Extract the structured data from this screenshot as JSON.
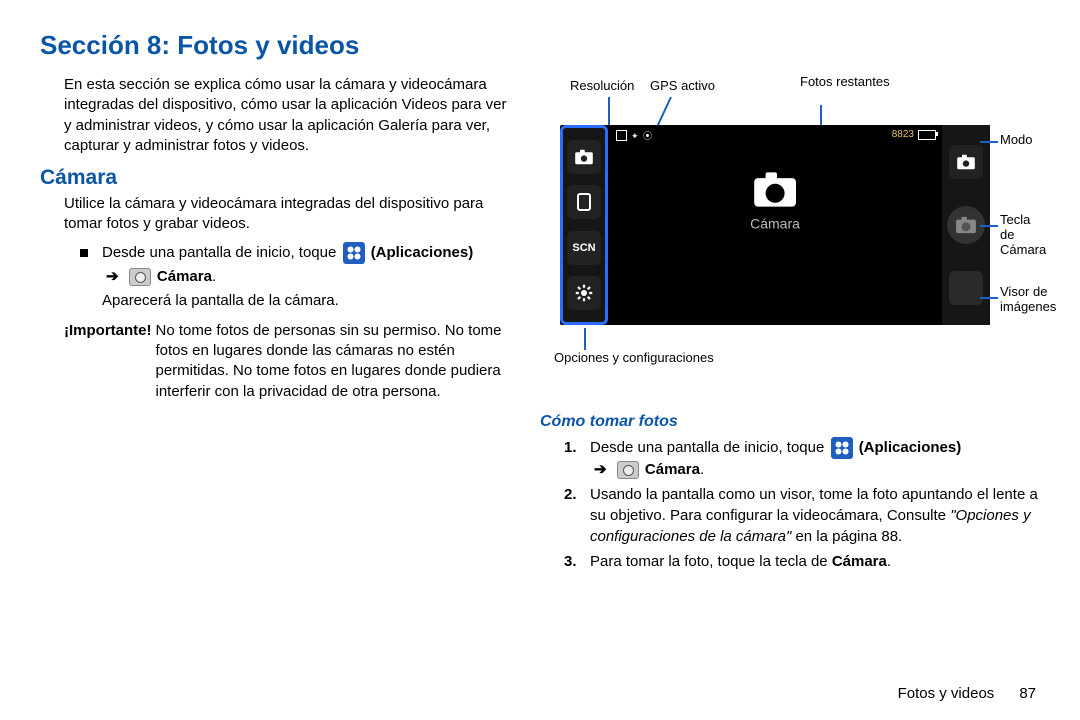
{
  "section_title": "Sección 8: Fotos y videos",
  "intro": "En esta sección se explica cómo usar la cámara y videocámara integradas del dispositivo, cómo usar la aplicación Videos para ver y administrar videos, y cómo usar la aplicación Galería para ver, capturar y administrar fotos y videos.",
  "camara": {
    "heading": "Cámara",
    "desc": "Utilice la cámara y videocámara integradas del dispositivo para tomar fotos y grabar videos.",
    "step_prefix": "Desde una pantalla de inicio, toque ",
    "apps_label": "(Aplicaciones)",
    "cam_label": "Cámara",
    "after": "Aparecerá la pantalla de la cámara."
  },
  "important": {
    "label": "¡Importante!",
    "text": "No tome fotos de personas sin su permiso. No tome fotos en lugares donde las cámaras no estén permitidas. No tome fotos en lugares donde pudiera interferir con la privacidad de otra persona."
  },
  "diagram_labels": {
    "resolucion": "Resolución",
    "gps": "GPS activo",
    "fotos_restantes": "Fotos restantes",
    "modo": "Modo",
    "tecla_camara": "Tecla de Cámara",
    "visor": "Visor de imágenes",
    "opciones": "Opciones y configuraciones",
    "center": "Cámara",
    "scn": "SCN",
    "counter": "8823"
  },
  "howto": {
    "heading": "Cómo tomar fotos",
    "steps": {
      "s1_prefix": "Desde una pantalla de inicio, toque ",
      "s1_apps": "(Aplicaciones)",
      "s1_cam": "Cámara",
      "s2a": "Usando la pantalla como un visor, tome la foto apuntando el lente a su objetivo. Para configurar la videocámara, Consulte ",
      "s2_ref": "\"Opciones y configuraciones de la cámara\"",
      "s2b": " en la página 88.",
      "s3a": "Para tomar la foto, toque la tecla de ",
      "s3b": "Cámara",
      "s3c": "."
    }
  },
  "footer": {
    "chapter": "Fotos y videos",
    "page": "87"
  }
}
